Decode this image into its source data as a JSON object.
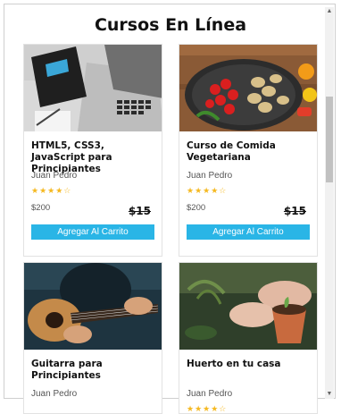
{
  "page": {
    "title": "Cursos En Línea"
  },
  "courses": [
    {
      "title": "HTML5, CSS3, JavaScript para Principiantes",
      "author": "Juan Pedro",
      "rating": 4.5,
      "stars": "★★★★☆",
      "price": "$200",
      "old_price": "$15",
      "button": "Agregar Al Carrito",
      "image": "laptop-image"
    },
    {
      "title": "Curso de Comida Vegetariana",
      "author": "Juan Pedro",
      "rating": 4.5,
      "stars": "★★★★☆",
      "price": "$200",
      "old_price": "$15",
      "button": "Agregar Al Carrito",
      "image": "vegetables-image"
    },
    {
      "title": "Guitarra para Principiantes",
      "author": "Juan Pedro",
      "image": "guitar-image"
    },
    {
      "title": "Huerto en tu casa",
      "author": "Juan Pedro",
      "rating": 4.5,
      "stars": "★★★★☆",
      "image": "garden-image"
    }
  ],
  "colors": {
    "accent": "#2ab5e6",
    "star": "#f5b921"
  }
}
